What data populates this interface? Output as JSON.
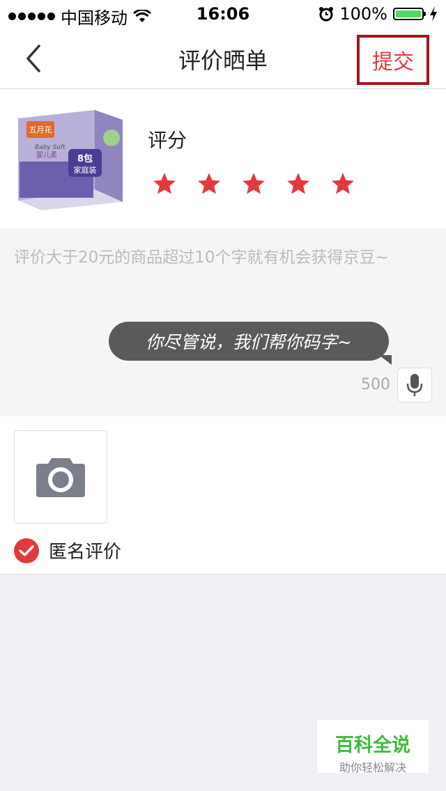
{
  "status_bar": {
    "carrier": "中国移动",
    "time": "16:06",
    "battery": "100%",
    "battery_level": 1.0
  },
  "nav": {
    "title": "评价晒单",
    "submit_label": "提交"
  },
  "product": {
    "rating_label": "评分",
    "rating": 5,
    "max_rating": 5,
    "star_color": "#e4393c",
    "thumb_text": {
      "brand": "五月花",
      "line": "Baby Soft",
      "line_cn": "婴儿柔",
      "pack": "8包",
      "pack_type": "家庭装"
    }
  },
  "review": {
    "placeholder": "评价大于20元的商品超过10个字就有机会获得京豆~",
    "bubble": "你尽管说，我们帮你码字~",
    "char_count": "500"
  },
  "anonymous": {
    "label": "匿名评价",
    "checked": true
  },
  "watermark": {
    "main": "百科全说",
    "sub": "助你轻松解决"
  },
  "colors": {
    "accent": "#e4393c",
    "background": "#efeff4"
  }
}
